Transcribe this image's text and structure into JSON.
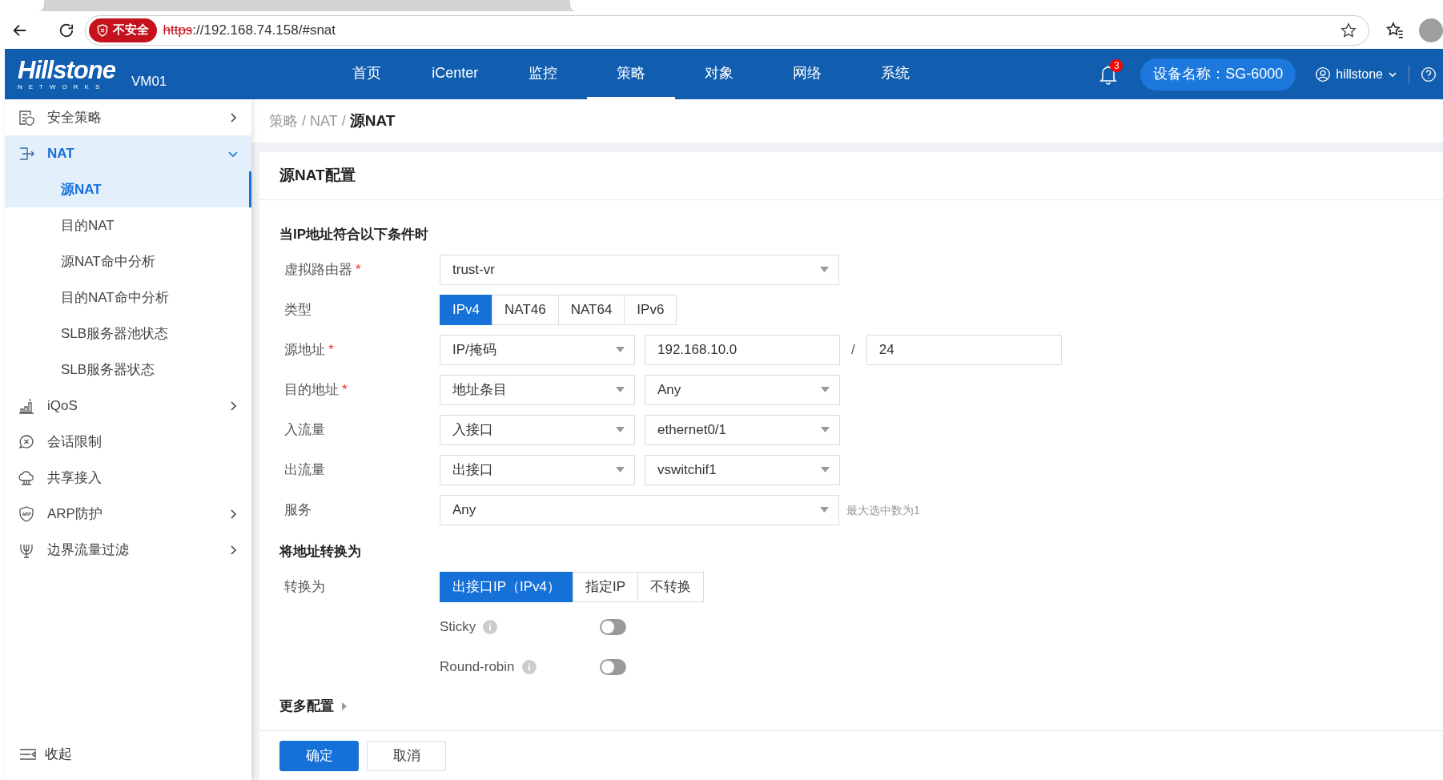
{
  "browser": {
    "security_label": "不安全",
    "scheme": "https",
    "url_rest": "://192.168.74.158/#snat"
  },
  "header": {
    "logo": "Hillstone",
    "logo_subtitle": "NETWORKS",
    "product": "VM01",
    "nav": [
      {
        "label": "首页",
        "selected": false
      },
      {
        "label": "iCenter",
        "selected": false
      },
      {
        "label": "监控",
        "selected": false
      },
      {
        "label": "策略",
        "selected": true
      },
      {
        "label": "对象",
        "selected": false
      },
      {
        "label": "网络",
        "selected": false
      },
      {
        "label": "系统",
        "selected": false
      }
    ],
    "notification_count": "3",
    "device_name": "设备名称：SG-6000",
    "user": "hillstone"
  },
  "sidebar": {
    "items": [
      {
        "label": "安全策略",
        "expanded": false,
        "selected": false
      },
      {
        "label": "NAT",
        "expanded": true,
        "selected": true,
        "children": [
          {
            "label": "源NAT",
            "selected": true
          },
          {
            "label": "目的NAT",
            "selected": false
          },
          {
            "label": "源NAT命中分析",
            "selected": false
          },
          {
            "label": "目的NAT命中分析",
            "selected": false
          },
          {
            "label": "SLB服务器池状态",
            "selected": false
          },
          {
            "label": "SLB服务器状态",
            "selected": false
          }
        ]
      },
      {
        "label": "iQoS",
        "expanded": false,
        "selected": false
      },
      {
        "label": "会话限制",
        "selected": false
      },
      {
        "label": "共享接入",
        "selected": false
      },
      {
        "label": "ARP防护",
        "expanded": false,
        "selected": false
      },
      {
        "label": "边界流量过滤",
        "expanded": false,
        "selected": false
      }
    ],
    "collapse_label": "收起"
  },
  "breadcrumb": {
    "separator": "/",
    "items": [
      "策略",
      "NAT",
      "源NAT"
    ]
  },
  "panel": {
    "title": "源NAT配置",
    "required_mark": "*",
    "sections": [
      {
        "title": "当IP地址符合以下条件时",
        "rows": [
          {
            "kind": "select",
            "label": "虚拟路由器",
            "required": true,
            "value": "trust-vr"
          },
          {
            "kind": "segmented",
            "label": "类型",
            "required": false,
            "options": [
              {
                "label": "IPv4",
                "selected": true
              },
              {
                "label": "NAT46",
                "selected": false
              },
              {
                "label": "NAT64",
                "selected": false
              },
              {
                "label": "IPv6",
                "selected": false
              }
            ]
          },
          {
            "kind": "ip_mask",
            "label": "源地址",
            "required": true,
            "type_value": "IP/掩码",
            "address": "192.168.10.0",
            "separator": "/",
            "mask": "24"
          },
          {
            "kind": "select_pair",
            "label": "目的地址",
            "required": true,
            "values": [
              "地址条目",
              "Any"
            ]
          },
          {
            "kind": "select_pair",
            "label": "入流量",
            "required": false,
            "values": [
              "入接口",
              "ethernet0/1"
            ]
          },
          {
            "kind": "select_pair",
            "label": "出流量",
            "required": false,
            "values": [
              "出接口",
              "vswitchif1"
            ]
          },
          {
            "kind": "select",
            "label": "服务",
            "required": false,
            "value": "Any",
            "hint": "最大选中数为1"
          }
        ]
      },
      {
        "title": "将地址转换为",
        "rows": [
          {
            "kind": "segmented",
            "label": "转换为",
            "required": false,
            "options": [
              {
                "label": "出接口IP（IPv4）",
                "selected": true
              },
              {
                "label": "指定IP",
                "selected": false
              },
              {
                "label": "不转换",
                "selected": false
              }
            ]
          },
          {
            "kind": "toggle",
            "label": "Sticky",
            "on": false
          },
          {
            "kind": "toggle",
            "label": "Round-robin",
            "on": false
          }
        ]
      }
    ],
    "more": {
      "label": "更多配置",
      "expanded": false
    },
    "buttons": [
      {
        "label": "确定",
        "kind": "primary"
      },
      {
        "label": "取消",
        "kind": "default"
      }
    ]
  }
}
